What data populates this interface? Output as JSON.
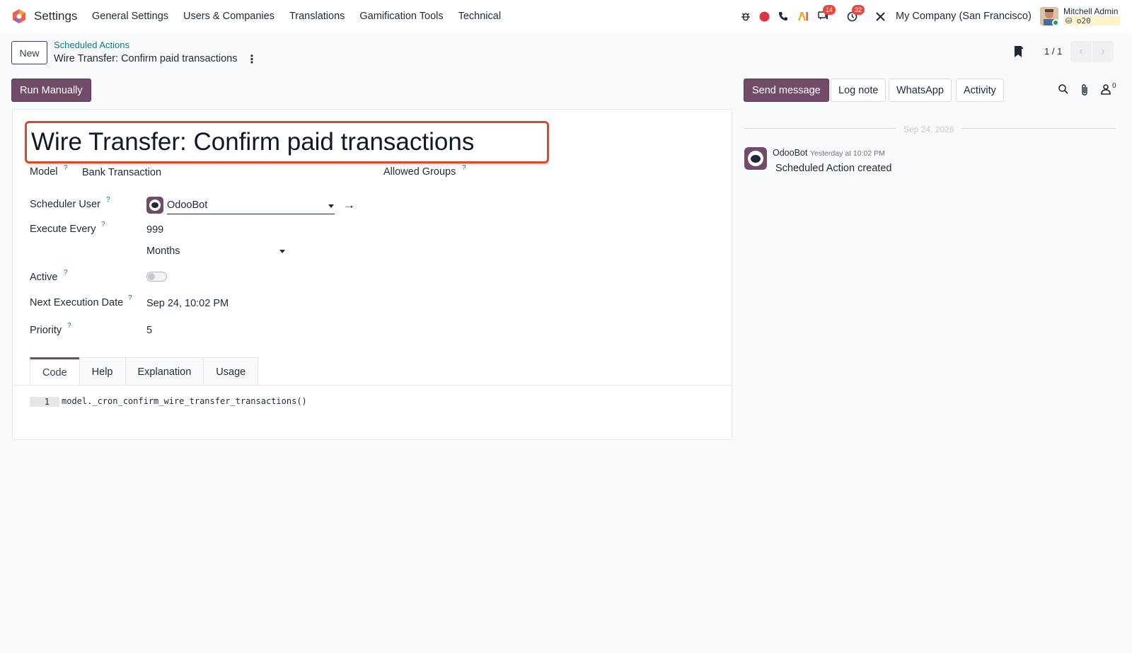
{
  "navbar": {
    "app_name": "Settings",
    "menu": [
      "General Settings",
      "Users & Companies",
      "Translations",
      "Gamification Tools",
      "Technical"
    ],
    "badges": {
      "messages": "14",
      "activities": "32"
    },
    "company": "My Company (San Francisco)",
    "user_name": "Mitchell Admin",
    "database": "o20"
  },
  "control_panel": {
    "new_label": "New",
    "breadcrumb": "Scheduled Actions",
    "record_name": "Wire Transfer: Confirm paid transactions",
    "pager": "1 / 1",
    "run_manually_label": "Run Manually"
  },
  "chatter_buttons": {
    "send_message": "Send message",
    "log_note": "Log note",
    "whatsapp": "WhatsApp",
    "activity": "Activity",
    "follower_count": "0"
  },
  "form": {
    "title": "Wire Transfer: Confirm paid transactions",
    "help_mark": "?",
    "model_label": "Model",
    "model_value": "Bank Transaction",
    "allowed_groups_label": "Allowed Groups",
    "scheduler_user_label": "Scheduler User",
    "scheduler_user_value": "OdooBot",
    "execute_every_label": "Execute Every",
    "execute_every_value": "999",
    "interval_unit": "Months",
    "active_label": "Active",
    "active_value": false,
    "next_exec_label": "Next Execution Date",
    "next_exec_value": "Sep 24, 10:02 PM",
    "priority_label": "Priority",
    "priority_value": "5"
  },
  "tabs": [
    "Code",
    "Help",
    "Explanation",
    "Usage"
  ],
  "code": {
    "line_number": "1",
    "line": "model._cron_confirm_wire_transfer_transactions()"
  },
  "chatter": {
    "date_separator": "Sep 24, 2026",
    "author": "OdooBot",
    "time": "Yesterday at 10:02 PM",
    "body": "Scheduled Action created"
  },
  "colors": {
    "brand": "#714b67",
    "link": "#017e84",
    "highlight_border": "#d9492b",
    "badge": "#e4483f"
  }
}
